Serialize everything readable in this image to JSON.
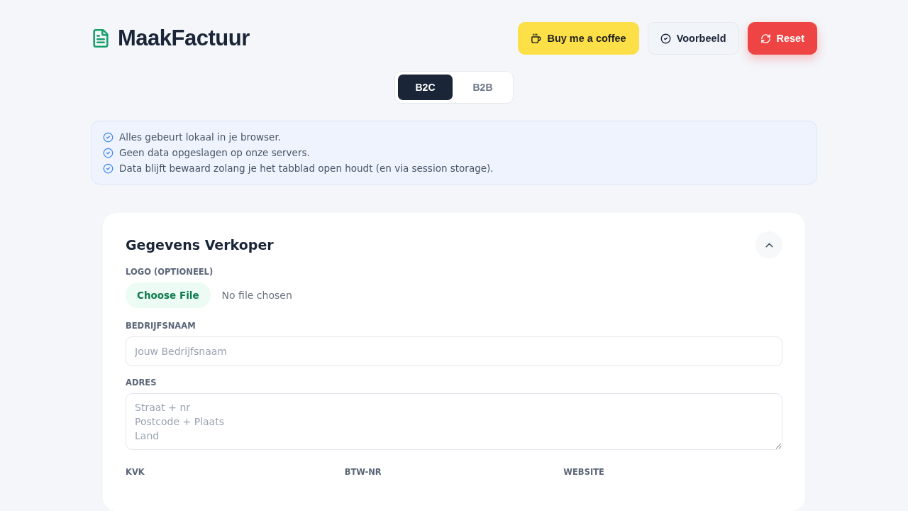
{
  "brand": {
    "name": "MaakFactuur"
  },
  "actions": [
    {
      "kind": "coffee",
      "label": "Buy me a coffee"
    },
    {
      "kind": "preview",
      "label": "Voorbeeld"
    },
    {
      "kind": "reset",
      "label": "Reset"
    }
  ],
  "mode_tabs": [
    {
      "label": "B2C",
      "selected": true
    },
    {
      "label": "B2B",
      "selected": false
    }
  ],
  "notices": [
    "Alles gebeurt lokaal in je browser.",
    "Geen data opgeslagen op onze servers.",
    "Data blijft bewaard zolang je het tabblad open houdt (en via session storage)."
  ],
  "section": {
    "title": "Gegevens Verkoper",
    "expanded": true,
    "logo": {
      "label": "LOGO (OPTIONEEL)",
      "button": "Choose File",
      "status": "No file chosen"
    },
    "company": {
      "label": "BEDRIJFSNAAM",
      "placeholder": "Jouw Bedrijfsnaam"
    },
    "address": {
      "label": "ADRES",
      "placeholder": "Straat + nr\nPostcode + Plaats\nLand"
    },
    "columns": [
      "KVK",
      "BTW-NR",
      "WEBSITE"
    ]
  }
}
